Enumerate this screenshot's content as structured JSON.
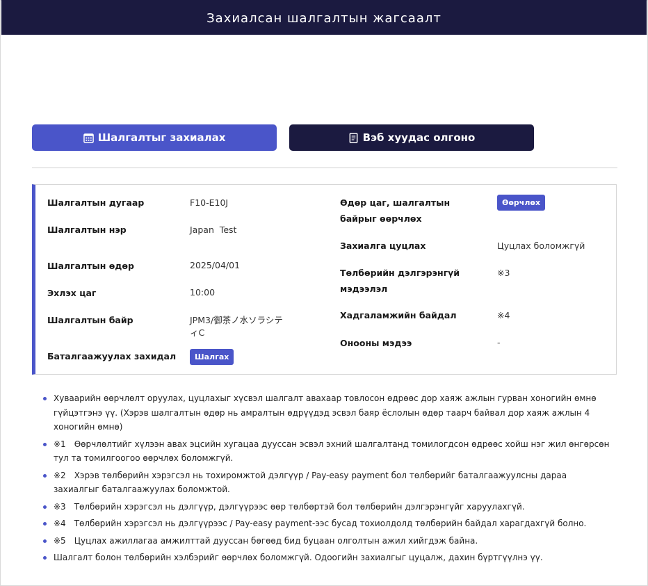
{
  "header": {
    "title": "Захиалсан шалгалтын жагсаалт"
  },
  "actions": {
    "reserve_label": "Шалгалтыг захиалах",
    "web_label": "Вэб хуудас олгоно"
  },
  "exam": {
    "number_label": "Шалгалтын дугаар",
    "number": "F10-E10J",
    "name_label": "Шалгалтын нэр",
    "name": "Japan  Test",
    "date_label": "Шалгалтын өдөр",
    "date": "2025/04/01",
    "start_label": "Эхлэх цаг",
    "start": "10:00",
    "venue_label": "Шалгалтын байр",
    "venue_line1": "JPM3/御茶ノ水ソラシテ",
    "venue_line2": "ィC",
    "confirm_label": "Баталгаажуулах захидал",
    "confirm_button": "Шалгах",
    "change_label_line1": "Өдөр цаг, шалгалтын",
    "change_label_line2": "байрыг өөрчлөх",
    "change_button": "Өөрчлөх",
    "cancel_label": "Захиалга цуцлах",
    "cancel_value": "Цуцлах боломжгүй",
    "payment_label_line1": "Төлбөрийн дэлгэрэнгүй",
    "payment_label_line2": "мэдээлэл",
    "payment_value": "※3",
    "storage_label": "Хадгаламжийн байдал",
    "storage_value": "※4",
    "score_label": "Онооны мэдээ",
    "score_value": "-"
  },
  "notes": [
    "Хуваарийн өөрчлөлт оруулах, цуцлахыг хүсвэл шалгалт авахаар товлосон өдрөөс дор хаяж ажлын гурван хоногийн өмнө гүйцэтгэнэ үү. (Хэрэв шалгалтын өдөр нь амралтын өдрүүдэд эсвэл баяр ёслолын өдөр таарч байвал дор хаяж ажлын 4 хоногийн өмнө)",
    "※1　Өөрчлөлтийг хүлээн авах эцсийн хугацаа дууссан эсвэл эхний шалгалтанд томилогдсон өдрөөс хойш нэг жил өнгөрсөн тул та томилгоогоо өөрчлөх боломжгүй.",
    "※2　Хэрэв төлбөрийн хэрэгсэл нь тохиромжтой дэлгүүр / Pay-easy payment бол төлбөрийг баталгаажуулсны дараа захиалгыг баталгаажуулах боломжтой.",
    "※3　Төлбөрийн хэрэгсэл нь дэлгүүр, дэлгүүрээс өөр төлбөртэй бол төлбөрийн дэлгэрэнгүйг харуулахгүй.",
    "※4　Төлбөрийн хэрэгсэл нь дэлгүүрээс / Pay-easy payment-ээс бусад тохиолдолд төлбөрийн байдал харагдахгүй болно.",
    "※5　Цуцлах ажиллагаа амжилттай дууссан бөгөөд бид буцаан олголтын ажил хийгдэж байна.",
    "Шалгалт болон төлбөрийн хэлбэрийг өөрчлөх боломжгүй. Одоогийн захиалгыг цуцалж, дахин бүртгүүлнэ үү."
  ],
  "colors": {
    "navy": "#1b1a40",
    "accent": "#4a55c9"
  },
  "icons": {
    "reserve": "calendar-icon",
    "web": "document-icon"
  }
}
